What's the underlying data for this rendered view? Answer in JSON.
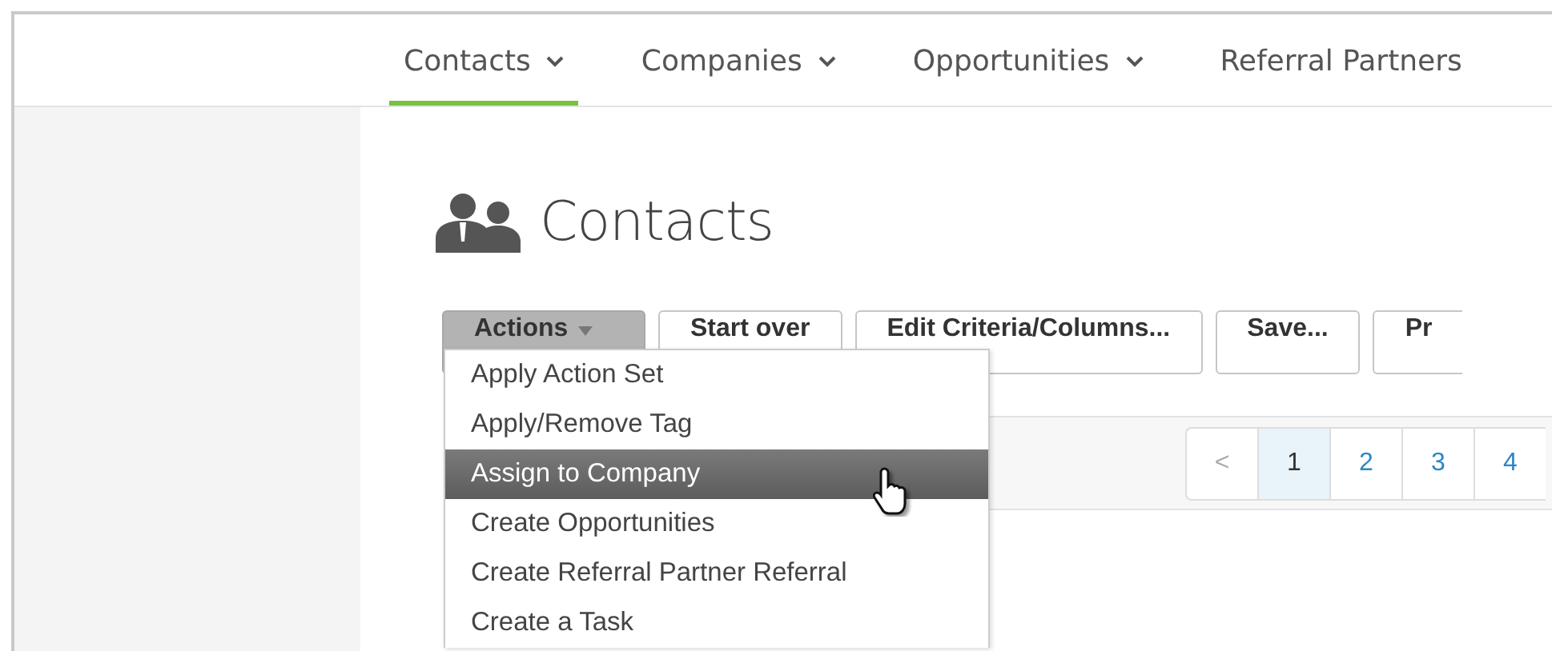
{
  "nav": {
    "tabs": [
      {
        "label": "Contacts",
        "selected": true
      },
      {
        "label": "Companies",
        "selected": false
      },
      {
        "label": "Opportunities",
        "selected": false
      },
      {
        "label": "Referral Partners",
        "selected": false
      }
    ]
  },
  "page": {
    "title": "Contacts"
  },
  "toolbar": {
    "buttons": [
      {
        "label": "Actions",
        "kind": "menu",
        "expanded": true
      },
      {
        "label": "Start over",
        "kind": "plain"
      },
      {
        "label": "Edit Criteria/Columns...",
        "kind": "plain"
      },
      {
        "label": "Save...",
        "kind": "plain"
      },
      {
        "label": "Pr",
        "kind": "plain"
      }
    ]
  },
  "actions_menu": {
    "items": [
      {
        "label": "Apply Action Set",
        "selected": false
      },
      {
        "label": "Apply/Remove Tag",
        "selected": false
      },
      {
        "label": "Assign to Company",
        "selected": true
      },
      {
        "label": "Create Opportunities",
        "selected": false
      },
      {
        "label": "Create Referral Partner Referral",
        "selected": false
      },
      {
        "label": "Create a Task",
        "selected": false
      }
    ]
  },
  "pagination": {
    "pages": [
      {
        "label": "<",
        "selected": false
      },
      {
        "label": "1",
        "selected": true
      },
      {
        "label": "2",
        "selected": false
      },
      {
        "label": "3",
        "selected": false
      },
      {
        "label": "4",
        "selected": false
      }
    ]
  }
}
